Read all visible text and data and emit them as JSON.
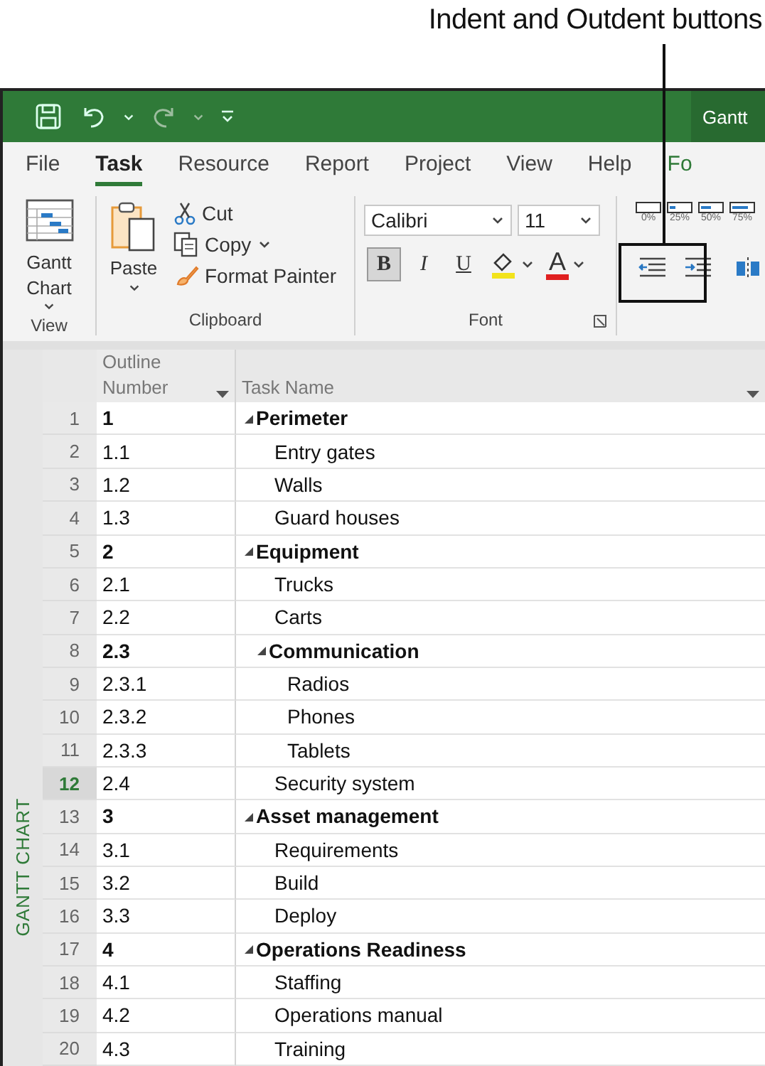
{
  "annotation": {
    "text": "Indent and Outdent buttons"
  },
  "window": {
    "title": "Gantt"
  },
  "tabs": [
    {
      "label": "File",
      "selected": false
    },
    {
      "label": "Task",
      "selected": true
    },
    {
      "label": "Resource",
      "selected": false
    },
    {
      "label": "Report",
      "selected": false
    },
    {
      "label": "Project",
      "selected": false
    },
    {
      "label": "View",
      "selected": false
    },
    {
      "label": "Help",
      "selected": false
    },
    {
      "label": "Fo",
      "selected": false
    }
  ],
  "ribbon": {
    "view_group": {
      "label": "View",
      "gantt_button": "Gantt Chart"
    },
    "clipboard_group": {
      "label": "Clipboard",
      "paste": "Paste",
      "cut": "Cut",
      "copy": "Copy",
      "format_painter": "Format Painter"
    },
    "font_group": {
      "label": "Font",
      "font_name": "Calibri",
      "font_size": "11",
      "styles": [
        {
          "label": "B",
          "kind": "bold",
          "selected": true
        },
        {
          "label": "I",
          "kind": "italic",
          "selected": false
        },
        {
          "label": "U",
          "kind": "underline",
          "selected": false
        }
      ],
      "text_color_label": "A"
    },
    "schedule_group": {
      "percent_buttons": [
        "0%",
        "25%",
        "50%",
        "75%"
      ]
    }
  },
  "view_bar": {
    "label": "GANTT CHART"
  },
  "table": {
    "columns": [
      "Outline Number",
      "Task Name"
    ],
    "rows": [
      {
        "row": "1",
        "outline": "1",
        "name": "Perimeter",
        "selected": false,
        "expanded": true,
        "children": [
          {
            "row": "2",
            "outline": "1.1",
            "name": "Entry gates",
            "selected": false
          },
          {
            "row": "3",
            "outline": "1.2",
            "name": "Walls",
            "selected": false
          },
          {
            "row": "4",
            "outline": "1.3",
            "name": "Guard houses",
            "selected": false
          }
        ]
      },
      {
        "row": "5",
        "outline": "2",
        "name": "Equipment",
        "selected": false,
        "expanded": true,
        "children": [
          {
            "row": "6",
            "outline": "2.1",
            "name": "Trucks",
            "selected": false
          },
          {
            "row": "7",
            "outline": "2.2",
            "name": "Carts",
            "selected": false
          },
          {
            "row": "8",
            "outline": "2.3",
            "name": "Communication",
            "selected": false,
            "expanded": true,
            "children": [
              {
                "row": "9",
                "outline": "2.3.1",
                "name": "Radios",
                "selected": false
              },
              {
                "row": "10",
                "outline": "2.3.2",
                "name": "Phones",
                "selected": false
              },
              {
                "row": "11",
                "outline": "2.3.3",
                "name": "Tablets",
                "selected": false
              }
            ]
          },
          {
            "row": "12",
            "outline": "2.4",
            "name": "Security system",
            "selected": true
          }
        ]
      },
      {
        "row": "13",
        "outline": "3",
        "name": "Asset management",
        "selected": false,
        "expanded": true,
        "children": [
          {
            "row": "14",
            "outline": "3.1",
            "name": "Requirements",
            "selected": false
          },
          {
            "row": "15",
            "outline": "3.2",
            "name": "Build",
            "selected": false
          },
          {
            "row": "16",
            "outline": "3.3",
            "name": "Deploy",
            "selected": false
          }
        ]
      },
      {
        "row": "17",
        "outline": "4",
        "name": "Operations Readiness",
        "selected": false,
        "expanded": true,
        "children": [
          {
            "row": "18",
            "outline": "4.1",
            "name": "Staffing",
            "selected": false
          },
          {
            "row": "19",
            "outline": "4.2",
            "name": "Operations manual",
            "selected": false
          },
          {
            "row": "20",
            "outline": "4.3",
            "name": "Training",
            "selected": false
          }
        ]
      }
    ]
  }
}
